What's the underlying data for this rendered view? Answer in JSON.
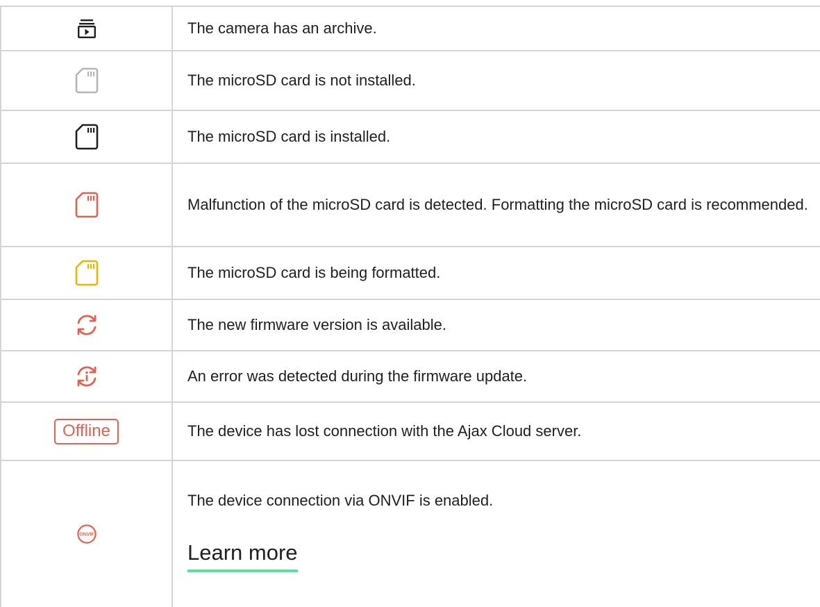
{
  "rows": [
    {
      "icon": "archive-icon",
      "text": "The camera has an archive."
    },
    {
      "icon": "microsd-card-icon",
      "color": "#b5b5b5",
      "text": "The microSD card is not installed."
    },
    {
      "icon": "microsd-card-icon",
      "color": "#1f1f1f",
      "text": "The microSD card is installed."
    },
    {
      "icon": "microsd-card-icon",
      "color": "#e5604f",
      "text": "Malfunction of the microSD card is detected. Formatting the microSD card is recommended."
    },
    {
      "icon": "microsd-card-icon",
      "color": "#f0b400",
      "text": "The microSD card is being formatted."
    },
    {
      "icon": "refresh-icon",
      "color": "#e5604f",
      "text": "The new firmware version is available."
    },
    {
      "icon": "refresh-error-icon",
      "color": "#e5604f",
      "text": "An error was detected during the firmware update."
    },
    {
      "badge": "Offline",
      "color": "#e5604f",
      "text": "The device has lost connection with the Ajax Cloud server."
    },
    {
      "icon": "onvif-icon",
      "icon_label": "ONVIF",
      "color": "#e5604f",
      "text": "The device connection via ONVIF is enabled.",
      "link": "Learn more",
      "link_underline_color": "#57e0a4"
    }
  ]
}
